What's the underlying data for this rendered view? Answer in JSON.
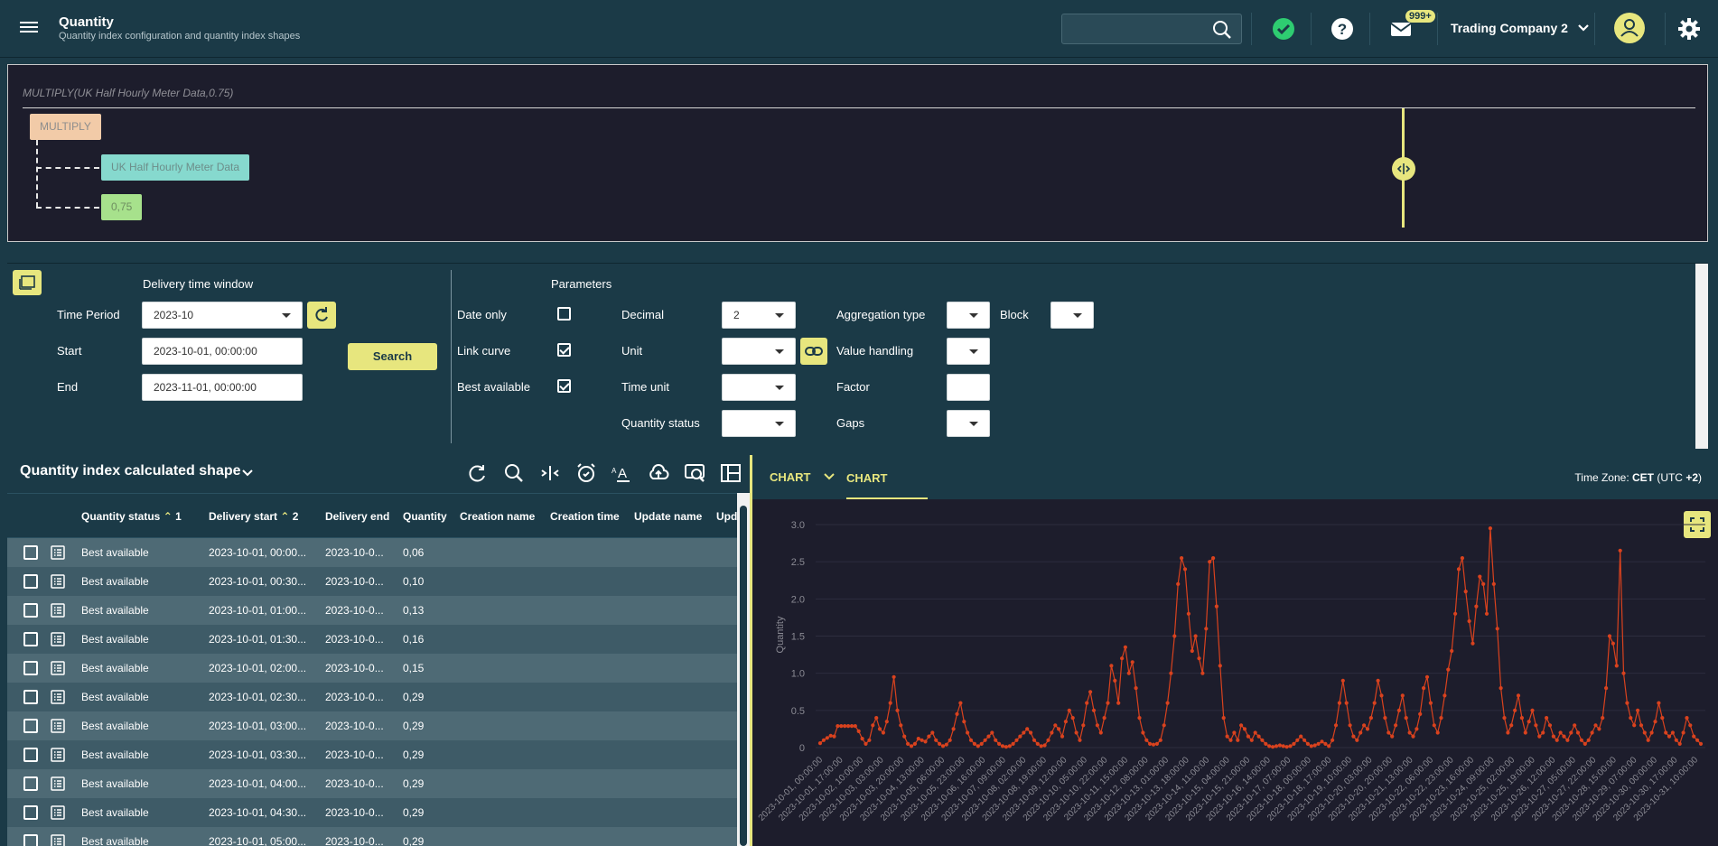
{
  "header": {
    "title": "Quantity",
    "subtitle": "Quantity index configuration and quantity index shapes",
    "search_placeholder": "",
    "notification_badge": "999+",
    "company": "Trading Company 2"
  },
  "formula": {
    "expression": "MULTIPLY(UK Half Hourly Meter Data,0.75)",
    "nodes": {
      "operator": "MULTIPLY",
      "input": "UK Half Hourly Meter Data",
      "factor": "0,75"
    }
  },
  "filters": {
    "delivery_window_title": "Delivery time window",
    "time_period_label": "Time Period",
    "time_period_value": "2023-10",
    "start_label": "Start",
    "start_value": "2023-10-01, 00:00:00",
    "end_label": "End",
    "end_value": "2023-11-01, 00:00:00",
    "search_label": "Search",
    "parameters_title": "Parameters",
    "date_only_label": "Date only",
    "date_only": false,
    "link_curve_label": "Link curve",
    "link_curve": true,
    "best_available_label": "Best available",
    "best_available": true,
    "decimal_label": "Decimal",
    "decimal_value": "2",
    "unit_label": "Unit",
    "unit_value": "",
    "time_unit_label": "Time unit",
    "time_unit_value": "",
    "quantity_status_label": "Quantity status",
    "quantity_status_value": "",
    "aggregation_type_label": "Aggregation type",
    "block_label": "Block",
    "value_handling_label": "Value handling",
    "factor_label": "Factor",
    "factor_value": "",
    "gaps_label": "Gaps"
  },
  "table": {
    "title": "Quantity index calculated shape",
    "columns": [
      {
        "label": "Quantity status",
        "sort_order": "1"
      },
      {
        "label": "Delivery start",
        "sort_order": "2"
      },
      {
        "label": "Delivery end"
      },
      {
        "label": "Quantity"
      },
      {
        "label": "Creation name"
      },
      {
        "label": "Creation time"
      },
      {
        "label": "Update name"
      },
      {
        "label": "Upd"
      }
    ],
    "rows": [
      {
        "status": "Best available",
        "start": "2023-10-01, 00:00...",
        "end": "2023-10-0...",
        "quantity": "0,06"
      },
      {
        "status": "Best available",
        "start": "2023-10-01, 00:30...",
        "end": "2023-10-0...",
        "quantity": "0,10"
      },
      {
        "status": "Best available",
        "start": "2023-10-01, 01:00...",
        "end": "2023-10-0...",
        "quantity": "0,13"
      },
      {
        "status": "Best available",
        "start": "2023-10-01, 01:30...",
        "end": "2023-10-0...",
        "quantity": "0,16"
      },
      {
        "status": "Best available",
        "start": "2023-10-01, 02:00...",
        "end": "2023-10-0...",
        "quantity": "0,15"
      },
      {
        "status": "Best available",
        "start": "2023-10-01, 02:30...",
        "end": "2023-10-0...",
        "quantity": "0,29"
      },
      {
        "status": "Best available",
        "start": "2023-10-01, 03:00...",
        "end": "2023-10-0...",
        "quantity": "0,29"
      },
      {
        "status": "Best available",
        "start": "2023-10-01, 03:30...",
        "end": "2023-10-0...",
        "quantity": "0,29"
      },
      {
        "status": "Best available",
        "start": "2023-10-01, 04:00...",
        "end": "2023-10-0...",
        "quantity": "0,29"
      },
      {
        "status": "Best available",
        "start": "2023-10-01, 04:30...",
        "end": "2023-10-0...",
        "quantity": "0,29"
      },
      {
        "status": "Best available",
        "start": "2023-10-01, 05:00...",
        "end": "2023-10-0...",
        "quantity": "0,29"
      }
    ]
  },
  "chart_panel": {
    "tab_dropdown": "CHART",
    "tab_active": "CHART",
    "timezone_prefix": "Time Zone: ",
    "timezone_name": "CET",
    "timezone_offset_prefix": " (UTC ",
    "timezone_offset": "+2",
    "timezone_suffix": ")"
  },
  "chart_data": {
    "type": "line",
    "title": "",
    "xlabel": "",
    "ylabel": "Quantity",
    "ylim": [
      0,
      3.0
    ],
    "yticks": [
      "0",
      "0.5",
      "1.0",
      "1.5",
      "2.0",
      "2.5",
      "3.0"
    ],
    "color": "#d9421e",
    "grid": true,
    "xtick_labels": [
      "2023-10-01, 00:00:00",
      "2023-10-01, 17:00:00",
      "2023-10-02, 10:00:00",
      "2023-10-03, 03:00:00",
      "2023-10-03, 20:00:00",
      "2023-10-04, 13:00:00",
      "2023-10-05, 06:00:00",
      "2023-10-05, 23:00:00",
      "2023-10-06, 16:00:00",
      "2023-10-07, 09:00:00",
      "2023-10-08, 02:00:00",
      "2023-10-08, 19:00:00",
      "2023-10-09, 12:00:00",
      "2023-10-10, 05:00:00",
      "2023-10-10, 22:00:00",
      "2023-10-11, 15:00:00",
      "2023-10-12, 08:00:00",
      "2023-10-13, 01:00:00",
      "2023-10-13, 18:00:00",
      "2023-10-14, 11:00:00",
      "2023-10-15, 04:00:00",
      "2023-10-15, 21:00:00",
      "2023-10-16, 14:00:00",
      "2023-10-17, 07:00:00",
      "2023-10-18, 00:00:00",
      "2023-10-18, 17:00:00",
      "2023-10-19, 10:00:00",
      "2023-10-20, 03:00:00",
      "2023-10-20, 20:00:00",
      "2023-10-21, 13:00:00",
      "2023-10-22, 06:00:00",
      "2023-10-22, 23:00:00",
      "2023-10-23, 16:00:00",
      "2023-10-24, 09:00:00",
      "2023-10-25, 02:00:00",
      "2023-10-25, 19:00:00",
      "2023-10-26, 12:00:00",
      "2023-10-27, 05:00:00",
      "2023-10-27, 22:00:00",
      "2023-10-28, 15:00:00",
      "2023-10-29, 07:00:00",
      "2023-10-30, 00:00:00",
      "2023-10-30, 17:00:00",
      "2023-10-31, 10:00:00"
    ],
    "series": [
      {
        "values": [
          0.06,
          0.1,
          0.13,
          0.16,
          0.15,
          0.29,
          0.29,
          0.29,
          0.29,
          0.29,
          0.29,
          0.22,
          0.12,
          0.05,
          0.1,
          0.3,
          0.4,
          0.25,
          0.2,
          0.35,
          0.6,
          0.95,
          0.5,
          0.3,
          0.15,
          0.05,
          0.02,
          0.05,
          0.12,
          0.1,
          0.08,
          0.15,
          0.2,
          0.1,
          0.05,
          0.02,
          0.04,
          0.1,
          0.25,
          0.45,
          0.6,
          0.35,
          0.2,
          0.1,
          0.05,
          0.02,
          0.05,
          0.1,
          0.15,
          0.2,
          0.1,
          0.05,
          0.02,
          0.01,
          0.02,
          0.05,
          0.1,
          0.15,
          0.2,
          0.25,
          0.2,
          0.1,
          0.05,
          0.02,
          0.03,
          0.1,
          0.2,
          0.3,
          0.25,
          0.15,
          0.35,
          0.5,
          0.4,
          0.2,
          0.1,
          0.3,
          0.6,
          0.75,
          0.5,
          0.3,
          0.2,
          0.4,
          0.6,
          1.1,
          0.9,
          0.6,
          1.2,
          1.35,
          1.0,
          1.15,
          0.8,
          0.4,
          0.2,
          0.1,
          0.05,
          0.04,
          0.05,
          0.1,
          0.3,
          0.6,
          1.0,
          1.5,
          2.2,
          2.55,
          2.4,
          1.8,
          1.3,
          1.5,
          1.2,
          1.0,
          1.6,
          2.5,
          2.55,
          1.9,
          1.1,
          0.4,
          0.15,
          0.1,
          0.2,
          0.1,
          0.3,
          0.25,
          0.15,
          0.1,
          0.2,
          0.15,
          0.1,
          0.05,
          0.02,
          0.01,
          0.02,
          0.03,
          0.02,
          0.01,
          0.02,
          0.05,
          0.1,
          0.15,
          0.1,
          0.05,
          0.02,
          0.03,
          0.05,
          0.08,
          0.05,
          0.02,
          0.1,
          0.3,
          0.6,
          0.9,
          0.6,
          0.3,
          0.15,
          0.1,
          0.2,
          0.3,
          0.25,
          0.4,
          0.6,
          0.9,
          0.7,
          0.4,
          0.2,
          0.15,
          0.3,
          0.5,
          0.7,
          0.4,
          0.2,
          0.15,
          0.25,
          0.45,
          0.8,
          0.95,
          0.6,
          0.3,
          0.2,
          0.4,
          0.7,
          1.05,
          1.3,
          1.8,
          2.4,
          2.55,
          2.1,
          1.7,
          1.4,
          1.9,
          2.3,
          2.2,
          1.8,
          2.95,
          2.2,
          1.6,
          0.8,
          0.4,
          0.2,
          0.3,
          0.5,
          0.7,
          0.4,
          0.2,
          0.35,
          0.5,
          0.3,
          0.15,
          0.2,
          0.4,
          0.3,
          0.15,
          0.1,
          0.2,
          0.15,
          0.1,
          0.2,
          0.3,
          0.2,
          0.1,
          0.05,
          0.1,
          0.2,
          0.3,
          0.25,
          0.4,
          0.8,
          1.5,
          1.4,
          1.1,
          2.65,
          1.0,
          0.6,
          0.4,
          0.3,
          0.5,
          0.3,
          0.2,
          0.1,
          0.2,
          0.35,
          0.6,
          0.4,
          0.2,
          0.15,
          0.2,
          0.1,
          0.05,
          0.2,
          0.4,
          0.3,
          0.15,
          0.1,
          0.05
        ]
      }
    ]
  }
}
